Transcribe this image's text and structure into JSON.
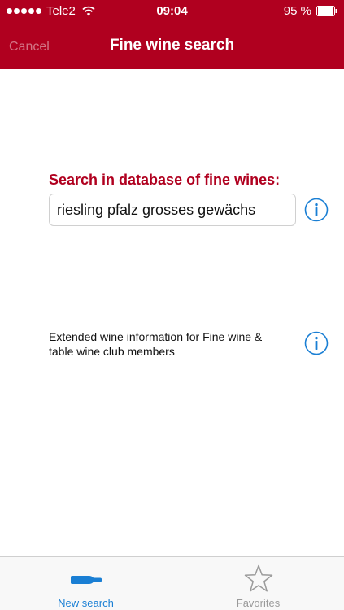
{
  "status_bar": {
    "carrier": "Tele2",
    "time": "09:04",
    "battery_percent": "95 %",
    "battery_level": 0.95,
    "signal_bars": 5,
    "wifi_icon": "wifi-icon"
  },
  "nav": {
    "cancel_label": "Cancel",
    "title": "Fine wine search"
  },
  "search": {
    "label": "Search in database of fine wines:",
    "value": "riesling pfalz grosses gewächs",
    "info_icon": "info-icon"
  },
  "extended": {
    "text": "Extended wine information for Fine wine & table wine club members",
    "info_icon": "info-icon"
  },
  "tabs": [
    {
      "label": "New search",
      "icon": "bottle-icon",
      "active": true
    },
    {
      "label": "Favorites",
      "icon": "star-icon",
      "active": false
    }
  ],
  "colors": {
    "brand": "#b0001f",
    "accent": "#1a7fd4",
    "inactive": "#9a9a9a"
  }
}
